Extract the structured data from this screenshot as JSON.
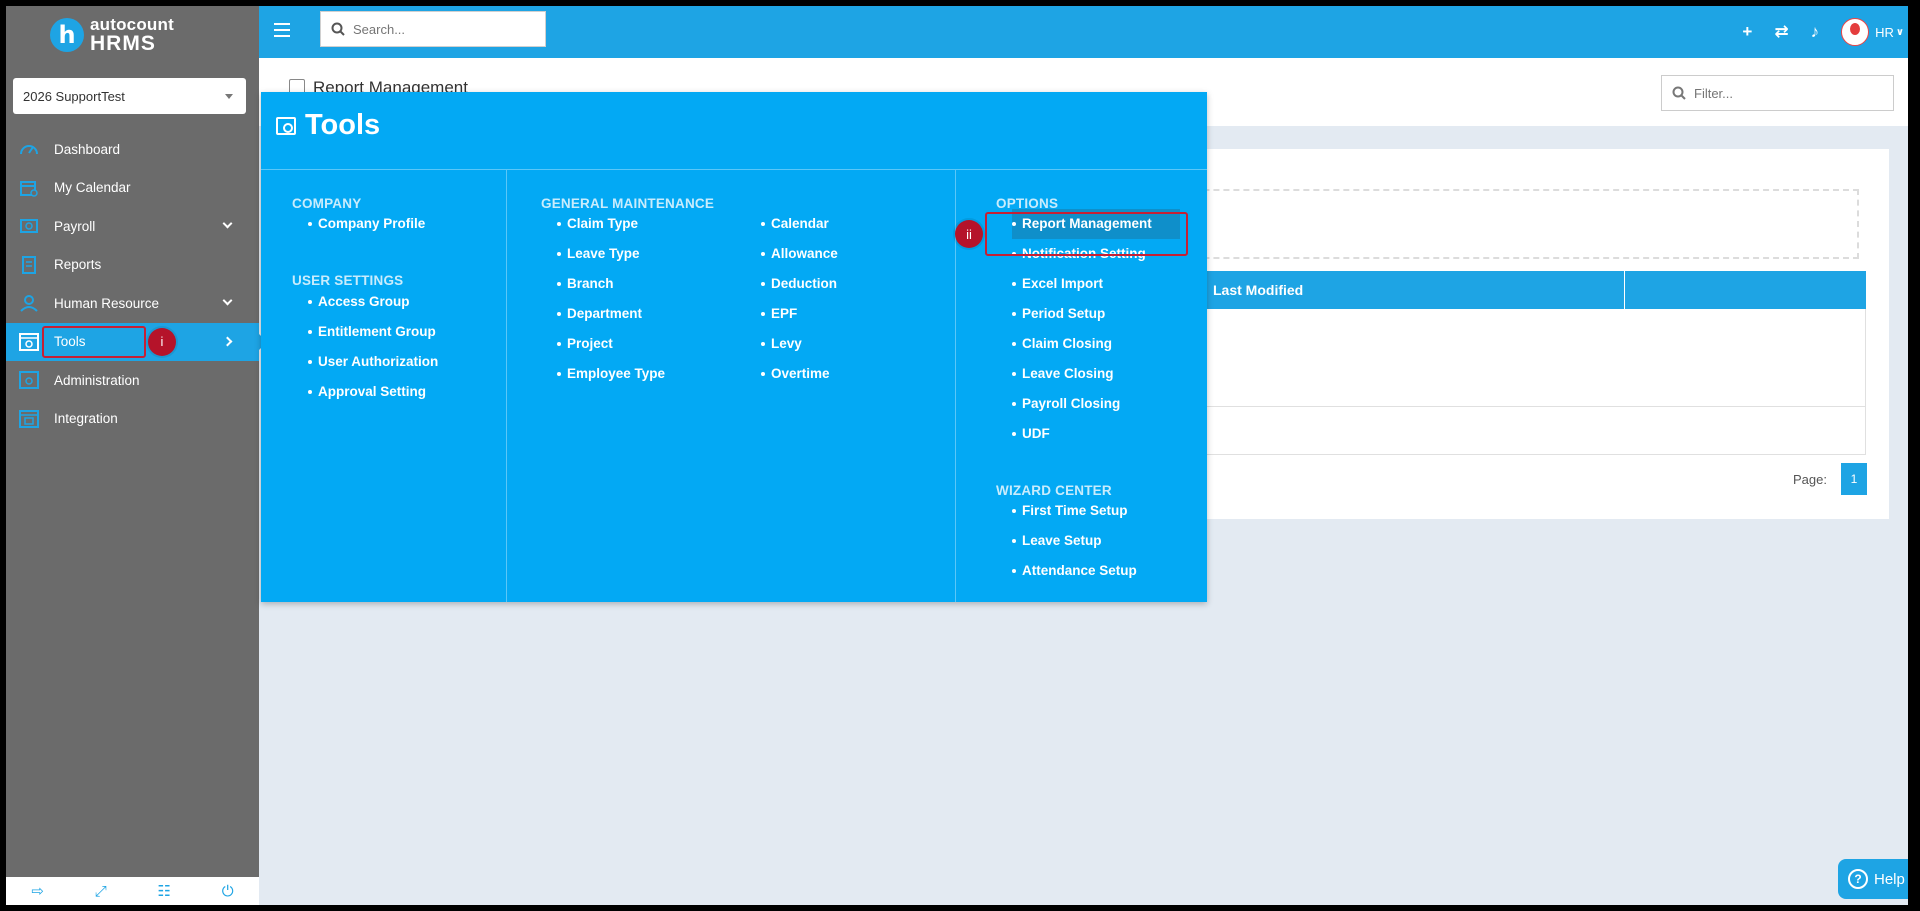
{
  "brand": {
    "logo_letter": "h",
    "line1": "autocount",
    "line2": "HRMS"
  },
  "company_select": {
    "value": "2026 SupportTest"
  },
  "sidebar": {
    "items": [
      {
        "label": "Dashboard",
        "icon": "dashboard-icon"
      },
      {
        "label": "My Calendar",
        "icon": "calendar-icon"
      },
      {
        "label": "Payroll",
        "icon": "payroll-icon"
      },
      {
        "label": "Reports",
        "icon": "reports-icon"
      },
      {
        "label": "Human Resource",
        "icon": "human-resource-icon"
      },
      {
        "label": "Tools",
        "icon": "tools-icon"
      },
      {
        "label": "Administration",
        "icon": "administration-icon"
      },
      {
        "label": "Integration",
        "icon": "integration-icon"
      }
    ],
    "bottom_icons": [
      "logout-icon",
      "fullscreen-icon",
      "language-icon",
      "power-icon"
    ]
  },
  "topbar": {
    "search_placeholder": "Search...",
    "user_label": "HR"
  },
  "page": {
    "title": "Report Management",
    "filter_placeholder": "Filter..."
  },
  "grid": {
    "columns": [
      "",
      "Last Modified",
      ""
    ],
    "pager_label": "Page:",
    "current_page": "1"
  },
  "annotations": {
    "step1": "i",
    "step2": "ii"
  },
  "tools_menu": {
    "title": "Tools",
    "company": {
      "heading": "COMPANY",
      "items": [
        "Company Profile"
      ]
    },
    "user_settings": {
      "heading": "USER SETTINGS",
      "items": [
        "Access Group",
        "Entitlement Group",
        "User Authorization",
        "Approval Setting"
      ]
    },
    "general_maintenance": {
      "heading": "GENERAL MAINTENANCE",
      "col1": [
        "Claim Type",
        "Leave Type",
        "Branch",
        "Department",
        "Project",
        "Employee Type"
      ],
      "col2": [
        "Calendar",
        "Allowance",
        "Deduction",
        "EPF",
        "Levy",
        "Overtime"
      ]
    },
    "options": {
      "heading": "OPTIONS",
      "items": [
        "Report Management",
        "Notification Setting",
        "Excel Import",
        "Period Setup",
        "Claim Closing",
        "Leave Closing",
        "Payroll Closing",
        "UDF"
      ]
    },
    "wizard_center": {
      "heading": "WIZARD CENTER",
      "items": [
        "First Time Setup",
        "Leave Setup",
        "Attendance Setup"
      ]
    }
  },
  "help": {
    "label": "Help"
  },
  "colors": {
    "accent": "#1ea4e4",
    "menu_bg": "#03a9f4",
    "sidebar_bg": "#6b6b6b",
    "highlight": "#c62035"
  }
}
